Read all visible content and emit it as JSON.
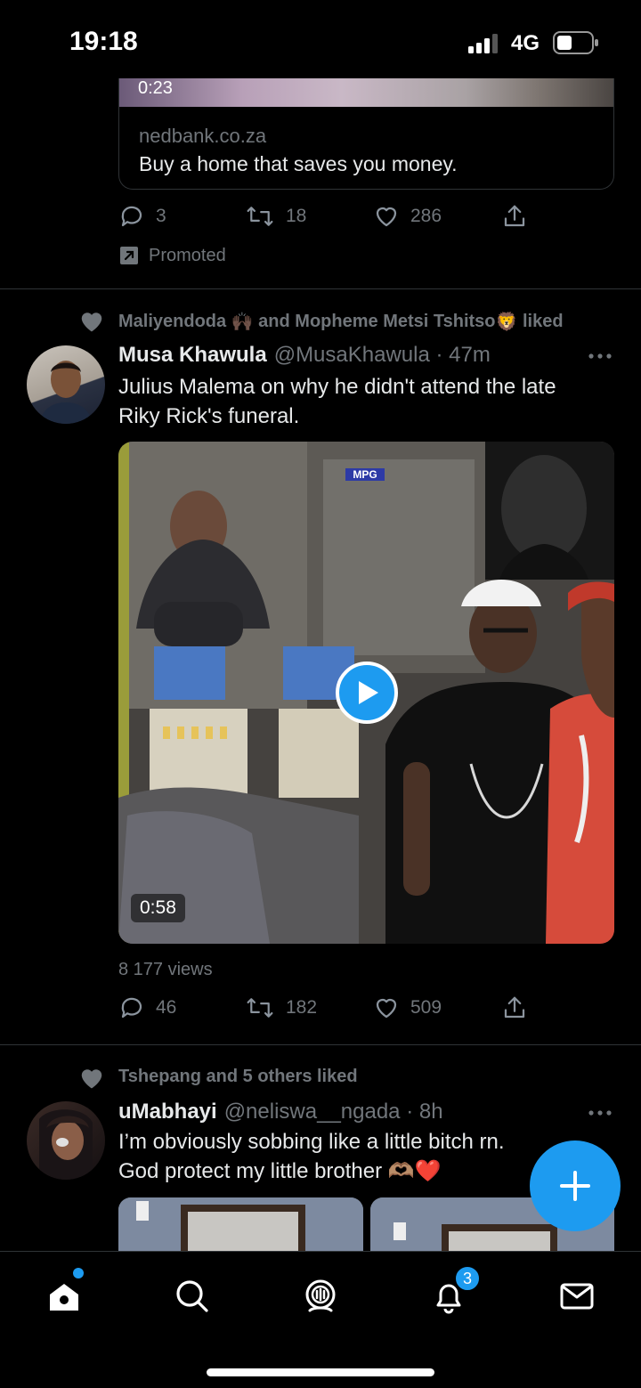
{
  "status_bar": {
    "time": "19:18",
    "network": "4G"
  },
  "promoted_tweet": {
    "card": {
      "video_duration": "0:23",
      "domain": "nedbank.co.za",
      "title": "Buy a home that saves you money."
    },
    "actions": {
      "replies": "3",
      "retweets": "18",
      "likes": "286"
    },
    "promoted_label": "Promoted"
  },
  "tweet1": {
    "social_context": {
      "name1": "Maliyendoda",
      "emoji1": "🙌🏿",
      "connector": "and",
      "name2": "Mopheme Metsi Tshitso",
      "emoji2": "🦁",
      "suffix": "liked"
    },
    "author_name": "Musa Khawula",
    "handle_time": "@MusaKhawula · 47m",
    "text_line1": "Julius Malema on why he didn't attend the late",
    "text_line2": "Riky Rick's funeral.",
    "video": {
      "duration": "0:58",
      "overlay_logo": "MPG"
    },
    "views": "8 177 views",
    "actions": {
      "replies": "46",
      "retweets": "182",
      "likes": "509"
    }
  },
  "tweet2": {
    "social_context": "Tshepang and 5 others liked",
    "author_name": "uMabhayi",
    "handle_time": "@neliswa__ngada · 8h",
    "text_line1": "I’m obviously sobbing like a little bitch rn.",
    "text_line2": "God protect my little brother 🫶🏽❤️"
  },
  "tab_bar": {
    "notifications_badge": "3"
  },
  "colors": {
    "accent": "#1d9bf0",
    "background": "#000000",
    "muted": "#71767b"
  }
}
